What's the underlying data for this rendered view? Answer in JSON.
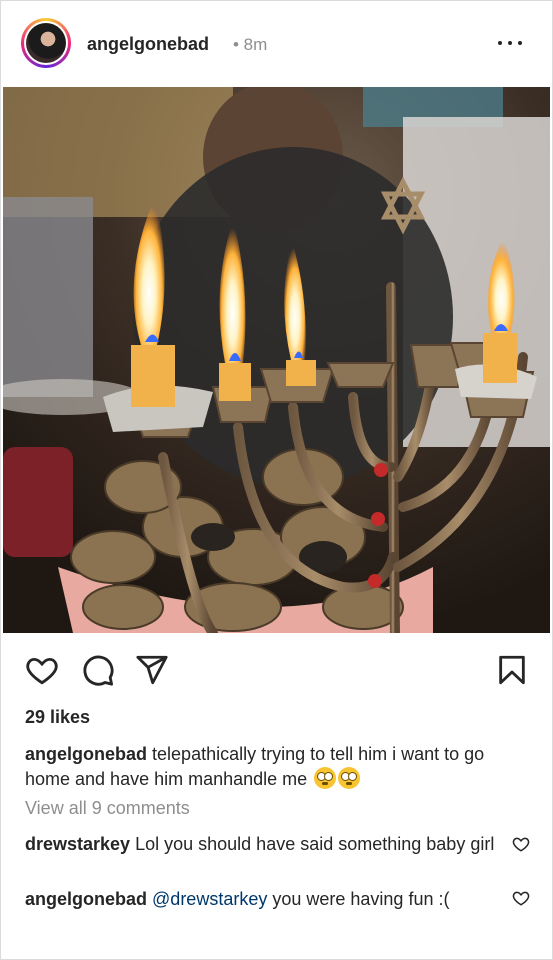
{
  "post": {
    "username": "angelgonebad",
    "time": "• 8m",
    "likes": "29 likes",
    "caption_user": "angelgonebad",
    "caption_text": "telepathically trying to tell him i want to go home and have him manhandle me",
    "view_all": "View all 9 comments"
  },
  "comments": [
    {
      "user": "drewstarkey",
      "text": "Lol you should have said something baby girl"
    },
    {
      "user": "angelgonebad",
      "mention": "@drewstarkey",
      "text": "you were having fun :("
    }
  ],
  "icons": {
    "like": "heart-icon",
    "comment": "comment-icon",
    "share": "share-icon",
    "save": "bookmark-icon",
    "more": "more-icon",
    "comment_like": "heart-icon",
    "emoji": "eye-roll-emoji"
  },
  "colors": {
    "text": "#262626",
    "muted": "#8e8e8e",
    "mention": "#00376b",
    "border": "#dbdbdb"
  }
}
